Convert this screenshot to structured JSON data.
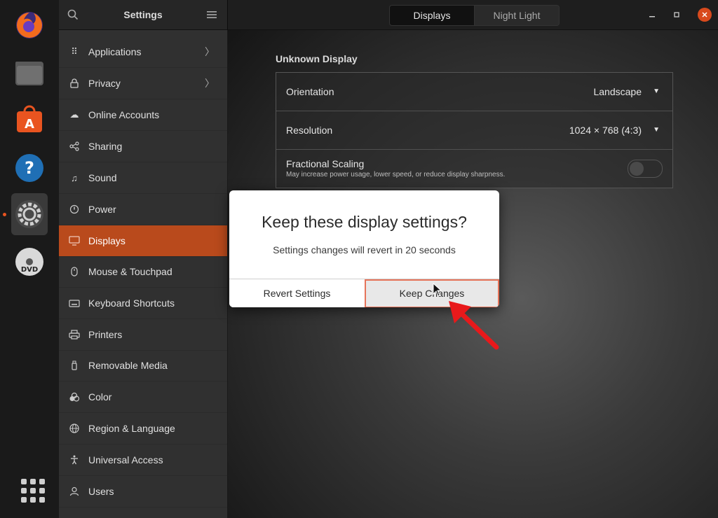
{
  "header": {
    "title": "Settings",
    "tabs": [
      {
        "label": "Displays",
        "active": true
      },
      {
        "label": "Night Light",
        "active": false
      }
    ]
  },
  "dock": {
    "items": [
      "firefox-icon",
      "files-icon",
      "software-icon",
      "help-icon",
      "settings-icon",
      "dvd-icon",
      "show-apps-icon"
    ]
  },
  "sidebar": {
    "items": [
      {
        "label": "Applications",
        "icon": "grid-icon",
        "chevron": true
      },
      {
        "label": "Privacy",
        "icon": "lock-icon",
        "chevron": true
      },
      {
        "label": "Online Accounts",
        "icon": "cloud-icon",
        "chevron": false
      },
      {
        "label": "Sharing",
        "icon": "share-icon",
        "chevron": false
      },
      {
        "label": "Sound",
        "icon": "music-note-icon",
        "chevron": false
      },
      {
        "label": "Power",
        "icon": "power-icon",
        "chevron": false
      },
      {
        "label": "Displays",
        "icon": "monitor-icon",
        "chevron": false,
        "active": true
      },
      {
        "label": "Mouse & Touchpad",
        "icon": "mouse-icon",
        "chevron": false
      },
      {
        "label": "Keyboard Shortcuts",
        "icon": "keyboard-icon",
        "chevron": false
      },
      {
        "label": "Printers",
        "icon": "printer-icon",
        "chevron": false
      },
      {
        "label": "Removable Media",
        "icon": "usb-icon",
        "chevron": false
      },
      {
        "label": "Color",
        "icon": "color-icon",
        "chevron": false
      },
      {
        "label": "Region & Language",
        "icon": "globe-icon",
        "chevron": false
      },
      {
        "label": "Universal Access",
        "icon": "accessibility-icon",
        "chevron": false
      },
      {
        "label": "Users",
        "icon": "user-icon",
        "chevron": false
      }
    ]
  },
  "display": {
    "section_title": "Unknown Display",
    "orientation": {
      "label": "Orientation",
      "value": "Landscape"
    },
    "resolution": {
      "label": "Resolution",
      "value": "1024 × 768 (4:3)"
    },
    "fractional_scaling": {
      "label": "Fractional Scaling",
      "description": "May increase power usage, lower speed, or reduce display sharpness.",
      "enabled": false
    }
  },
  "dialog": {
    "title": "Keep these display settings?",
    "message": "Settings changes will revert in 20 seconds",
    "revert_label": "Revert Settings",
    "keep_label": "Keep Changes"
  },
  "colors": {
    "accent": "#e95420",
    "sidebar_active": "#b94a1c",
    "arrow": "#e8191b"
  }
}
